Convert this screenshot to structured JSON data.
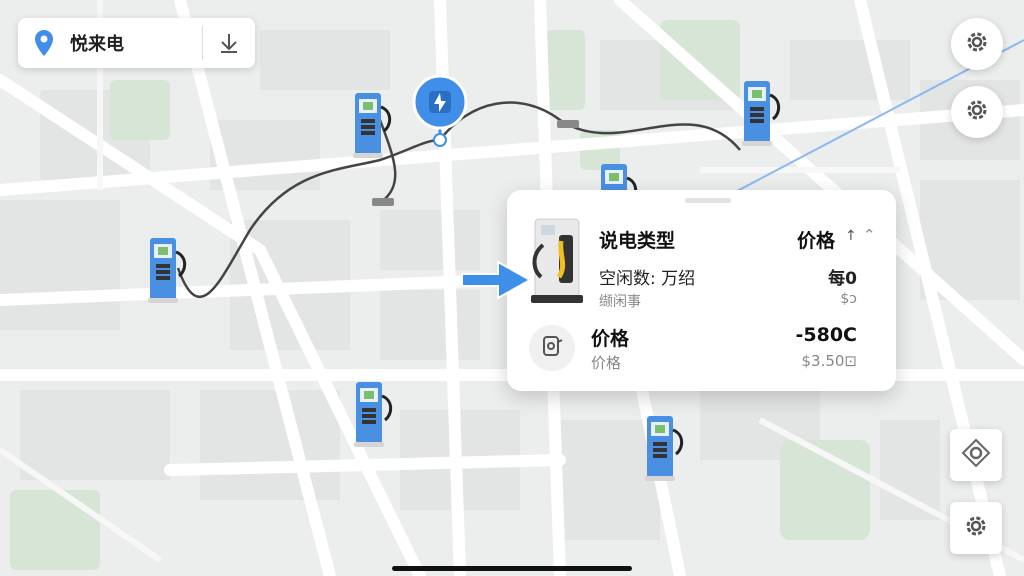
{
  "search": {
    "label": "悦来电",
    "pin_icon": "location-pin-icon",
    "download_icon": "download-arrow-icon"
  },
  "card": {
    "title": "说电类型",
    "price_header": "价格",
    "sort_icon": "arrow-up-icon",
    "collapse_icon": "chevron-up-icon",
    "idle_label": "空闲数: 万绍",
    "idle_value": "每0",
    "sub_label": "缬闲事",
    "sub_value": "$ɔ",
    "price_label": "价格",
    "price_value": "-580C",
    "price_sub_label": "价格",
    "price_sub_value": "$3.50⊡"
  },
  "colors": {
    "accent": "#3f8fe8",
    "charger_blue": "#4a90e2"
  }
}
